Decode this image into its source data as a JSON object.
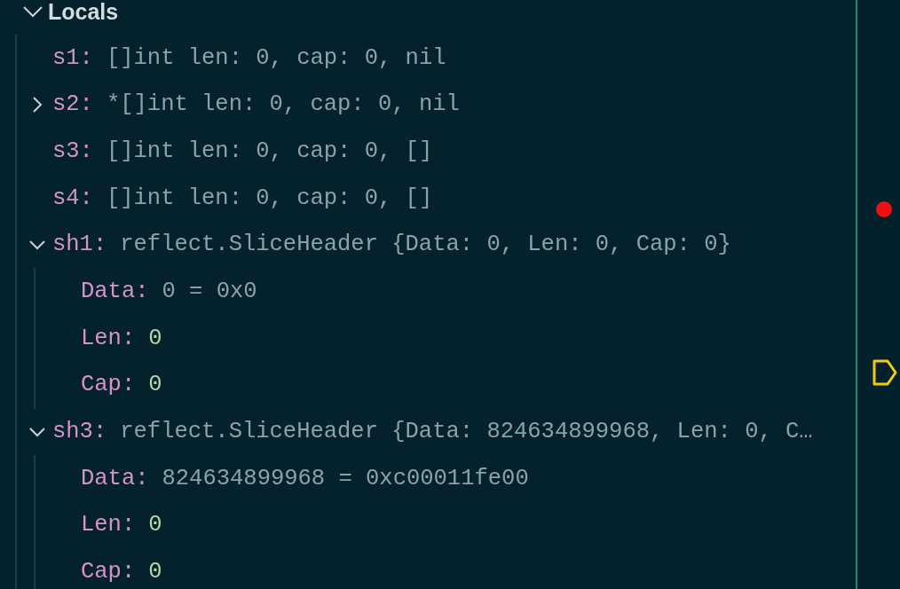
{
  "section": {
    "title": "Locals",
    "expanded": true
  },
  "variables": [
    {
      "name": "s1:",
      "value": "[]int len: 0, cap: 0, nil",
      "kind": "text"
    },
    {
      "name": "s2:",
      "value": "*[]int len: 0, cap: 0, nil",
      "kind": "text",
      "expanded": false
    },
    {
      "name": "s3:",
      "value": "[]int len: 0, cap: 0, []",
      "kind": "text"
    },
    {
      "name": "s4:",
      "value": "[]int len: 0, cap: 0, []",
      "kind": "text"
    },
    {
      "name": "sh1:",
      "value": "reflect.SliceHeader {Data: 0, Len: 0, Cap: 0}",
      "kind": "text",
      "expanded": true,
      "children": [
        {
          "name": "Data:",
          "value": "0 = 0x0",
          "kind": "text"
        },
        {
          "name": "Len:",
          "value": "0",
          "kind": "number"
        },
        {
          "name": "Cap:",
          "value": "0",
          "kind": "number"
        }
      ]
    },
    {
      "name": "sh3:",
      "value": "reflect.SliceHeader {Data: 824634899968, Len: 0, C…",
      "kind": "text",
      "expanded": true,
      "children": [
        {
          "name": "Data:",
          "value": "824634899968 = 0xc00011fe00",
          "kind": "text"
        },
        {
          "name": "Len:",
          "value": "0",
          "kind": "number"
        },
        {
          "name": "Cap:",
          "value": "0",
          "kind": "number"
        }
      ]
    }
  ]
}
